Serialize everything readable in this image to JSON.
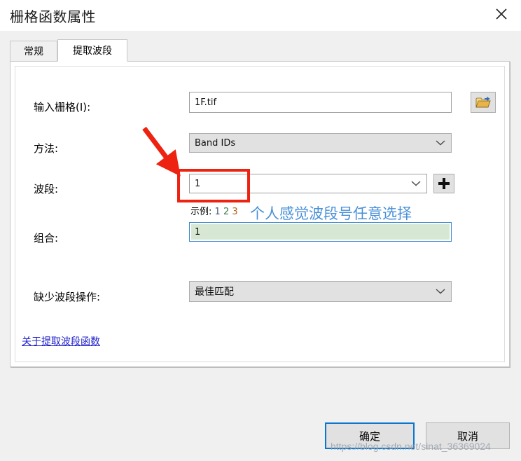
{
  "window": {
    "title": "栅格函数属性",
    "close_icon": "close-icon"
  },
  "tabs": [
    {
      "label": "常规",
      "active": false
    },
    {
      "label": "提取波段",
      "active": true
    }
  ],
  "form": {
    "input_raster": {
      "label": "输入栅格(I):",
      "value": "1F.tif",
      "browse_icon": "open-folder-icon"
    },
    "method": {
      "label": "方法:",
      "value": "Band IDs",
      "chevron_icon": "chevron-down-icon",
      "disabled": true
    },
    "bands": {
      "label": "波段:",
      "value": "1",
      "chevron_icon": "chevron-down-icon",
      "add_icon": "plus-icon",
      "hint_prefix": "示例:",
      "hint_d1": "1",
      "hint_d2": "2",
      "hint_d3": "3"
    },
    "combination": {
      "label": "组合:",
      "value": "1"
    },
    "missing_band_action": {
      "label": "缺少波段操作:",
      "value": "最佳匹配",
      "chevron_icon": "chevron-down-icon"
    },
    "help_link": "关于提取波段函数"
  },
  "buttons": {
    "ok": "确定",
    "cancel": "取消"
  },
  "annotations": {
    "note_text": "个人感觉波段号任意选择",
    "highlight_color": "#ee2211",
    "note_color": "#4a90d9",
    "arrow_icon": "red-arrow-icon"
  },
  "watermark": "https://blog.csdn.net/sinat_36369024"
}
